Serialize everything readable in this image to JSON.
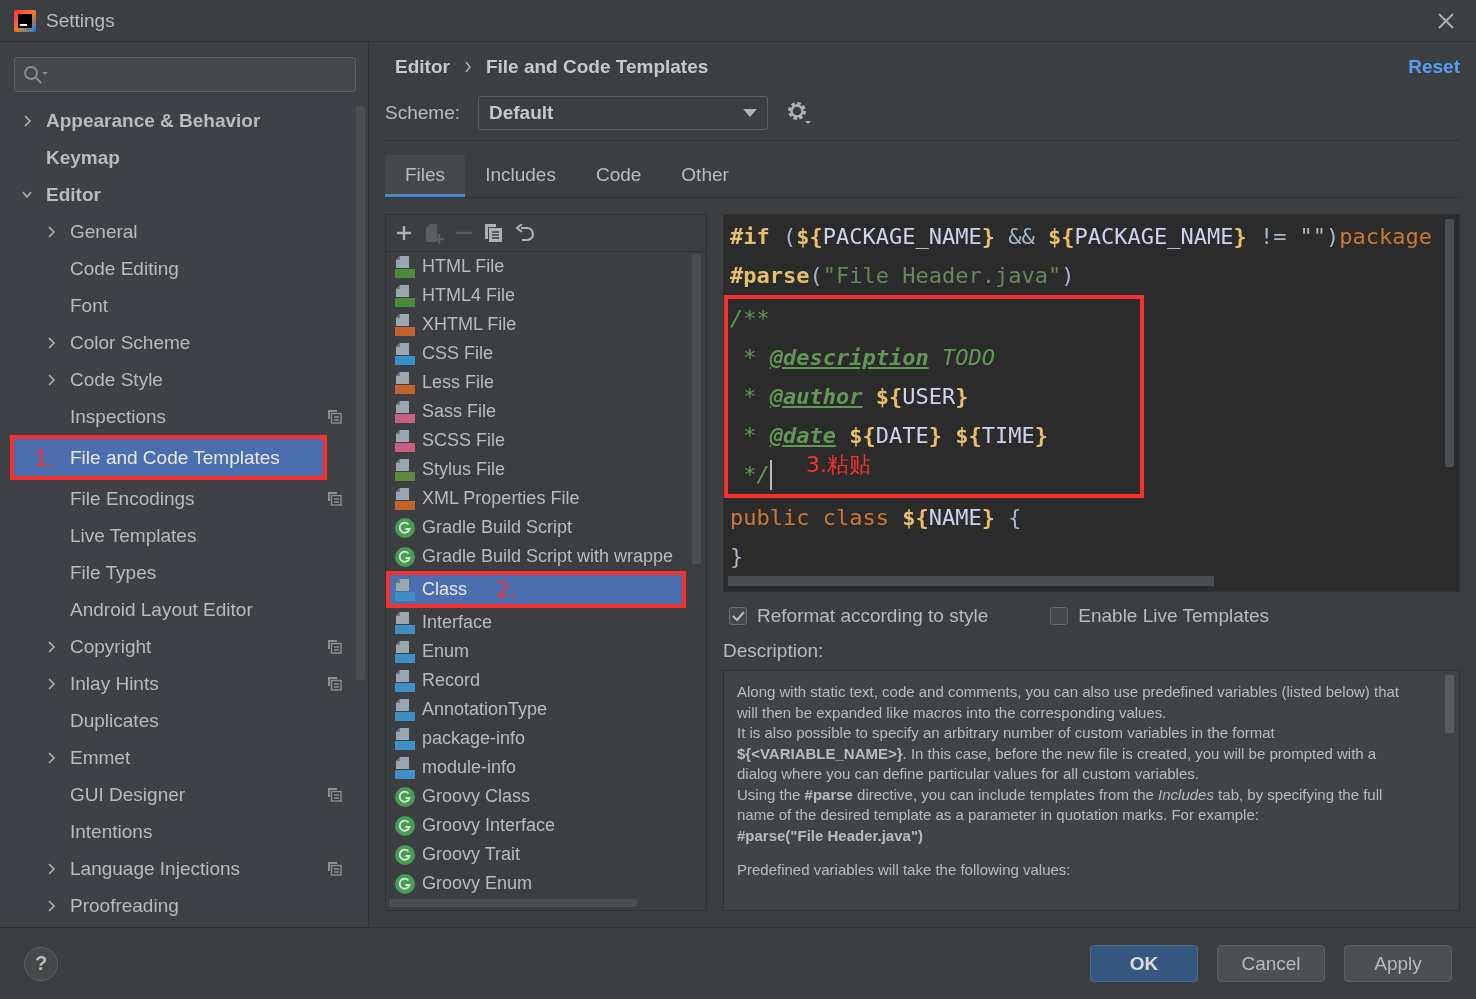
{
  "window": {
    "title": "Settings"
  },
  "sidebar": {
    "items": [
      {
        "label": "Appearance & Behavior",
        "expanded": false,
        "shared": false,
        "selected": false
      },
      {
        "label": "Keymap",
        "shared": false,
        "selected": false
      },
      {
        "label": "Editor",
        "expanded": true,
        "shared": false,
        "selected": false,
        "children": [
          {
            "label": "General",
            "expanded": false,
            "shared": false,
            "selected": false
          },
          {
            "label": "Code Editing",
            "shared": false,
            "selected": false
          },
          {
            "label": "Font",
            "shared": false,
            "selected": false
          },
          {
            "label": "Color Scheme",
            "expanded": false,
            "shared": false,
            "selected": false
          },
          {
            "label": "Code Style",
            "expanded": false,
            "shared": false,
            "selected": false
          },
          {
            "label": "Inspections",
            "shared": true,
            "selected": false
          },
          {
            "label": "File and Code Templates",
            "shared": false,
            "selected": true,
            "annotation": "1."
          },
          {
            "label": "File Encodings",
            "shared": true,
            "selected": false
          },
          {
            "label": "Live Templates",
            "shared": false,
            "selected": false
          },
          {
            "label": "File Types",
            "shared": false,
            "selected": false
          },
          {
            "label": "Android Layout Editor",
            "shared": false,
            "selected": false
          },
          {
            "label": "Copyright",
            "expanded": false,
            "shared": true,
            "selected": false
          },
          {
            "label": "Inlay Hints",
            "expanded": false,
            "shared": true,
            "selected": false
          },
          {
            "label": "Duplicates",
            "shared": false,
            "selected": false
          },
          {
            "label": "Emmet",
            "expanded": false,
            "shared": false,
            "selected": false
          },
          {
            "label": "GUI Designer",
            "shared": true,
            "selected": false
          },
          {
            "label": "Intentions",
            "shared": false,
            "selected": false
          },
          {
            "label": "Language Injections",
            "expanded": false,
            "shared": true,
            "selected": false
          },
          {
            "label": "Proofreading",
            "expanded": false,
            "shared": false,
            "selected": false
          }
        ]
      }
    ]
  },
  "breadcrumb": [
    "Editor",
    "File and Code Templates"
  ],
  "reset_link": "Reset",
  "scheme": {
    "label": "Scheme:",
    "value": "Default"
  },
  "tabs": [
    {
      "label": "Files",
      "selected": true
    },
    {
      "label": "Includes",
      "selected": false
    },
    {
      "label": "Code",
      "selected": false
    },
    {
      "label": "Other",
      "selected": false
    }
  ],
  "toolbar": [
    {
      "kind": "add",
      "disabled": false
    },
    {
      "kind": "add-child",
      "disabled": true
    },
    {
      "kind": "remove",
      "disabled": true
    },
    {
      "kind": "copy",
      "disabled": false
    },
    {
      "kind": "revert",
      "disabled": false
    }
  ],
  "templates": [
    {
      "label": "HTML File",
      "kind": "file",
      "color": "#4a8a3b",
      "selected": false
    },
    {
      "label": "HTML4 File",
      "kind": "file",
      "color": "#4a8a3b",
      "selected": false
    },
    {
      "label": "XHTML File",
      "kind": "file",
      "color": "#c3622c",
      "selected": false
    },
    {
      "label": "CSS File",
      "kind": "file",
      "color": "#3592c4",
      "selected": false
    },
    {
      "label": "Less File",
      "kind": "file",
      "color": "#c3622c",
      "selected": false
    },
    {
      "label": "Sass File",
      "kind": "file",
      "color": "#c75f80",
      "selected": false
    },
    {
      "label": "SCSS File",
      "kind": "file",
      "color": "#c75f80",
      "selected": false
    },
    {
      "label": "Stylus File",
      "kind": "file",
      "color": "#5b8a3a",
      "selected": false
    },
    {
      "label": "XML Properties File",
      "kind": "file",
      "color": "#c3622c",
      "selected": false
    },
    {
      "label": "Gradle Build Script",
      "kind": "circle",
      "color": "#499c54",
      "selected": false
    },
    {
      "label": "Gradle Build Script with wrappe",
      "kind": "circle",
      "color": "#499c54",
      "selected": false
    },
    {
      "label": "Class",
      "kind": "file",
      "color": "#3d8fc6",
      "selected": true,
      "annotation": "2."
    },
    {
      "label": "Interface",
      "kind": "file",
      "color": "#3d8fc6",
      "selected": false
    },
    {
      "label": "Enum",
      "kind": "file",
      "color": "#3d8fc6",
      "selected": false
    },
    {
      "label": "Record",
      "kind": "file",
      "color": "#3d8fc6",
      "selected": false
    },
    {
      "label": "AnnotationType",
      "kind": "file",
      "color": "#3d8fc6",
      "selected": false
    },
    {
      "label": "package-info",
      "kind": "file",
      "color": "#3d8fc6",
      "selected": false
    },
    {
      "label": "module-info",
      "kind": "file",
      "color": "#3d8fc6",
      "selected": false
    },
    {
      "label": "Groovy Class",
      "kind": "circle",
      "color": "#499c54",
      "selected": false
    },
    {
      "label": "Groovy Interface",
      "kind": "circle",
      "color": "#499c54",
      "selected": false
    },
    {
      "label": "Groovy Trait",
      "kind": "circle",
      "color": "#499c54",
      "selected": false
    },
    {
      "label": "Groovy Enum",
      "kind": "circle",
      "color": "#499c54",
      "selected": false
    }
  ],
  "code": {
    "before": [
      {
        "cursor": false,
        "tokens": [
          {
            "kind": "dir",
            "t": "#if"
          },
          {
            "kind": "plain",
            "t": " ("
          },
          {
            "kind": "brace",
            "t": "${"
          },
          {
            "kind": "var",
            "t": "PACKAGE_NAME"
          },
          {
            "kind": "brace",
            "t": "}"
          },
          {
            "kind": "plain",
            "t": " && "
          },
          {
            "kind": "brace",
            "t": "${"
          },
          {
            "kind": "var",
            "t": "PACKAGE_NAME"
          },
          {
            "kind": "brace",
            "t": "}"
          },
          {
            "kind": "plain",
            "t": " != \"\")"
          },
          {
            "kind": "kw",
            "t": "package"
          }
        ]
      },
      {
        "cursor": false,
        "tokens": [
          {
            "kind": "dir",
            "t": "#parse"
          },
          {
            "kind": "plain",
            "t": "("
          },
          {
            "kind": "str",
            "t": "\"File Header.java\""
          },
          {
            "kind": "plain",
            "t": ")"
          }
        ]
      }
    ],
    "annotated": {
      "label": "3.粘贴",
      "lines": [
        {
          "cursor": false,
          "tokens": [
            {
              "kind": "cmt",
              "t": "/**"
            }
          ]
        },
        {
          "cursor": false,
          "tokens": [
            {
              "kind": "cmt",
              "t": " * "
            },
            {
              "kind": "tag",
              "t": "@description"
            },
            {
              "kind": "cmt",
              "t": " TODO"
            }
          ]
        },
        {
          "cursor": false,
          "tokens": [
            {
              "kind": "cmt",
              "t": " * "
            },
            {
              "kind": "tag",
              "t": "@author"
            },
            {
              "kind": "brace",
              "t": " ${"
            },
            {
              "kind": "var",
              "t": "USER"
            },
            {
              "kind": "brace",
              "t": "}"
            }
          ]
        },
        {
          "cursor": false,
          "tokens": [
            {
              "kind": "cmt",
              "t": " * "
            },
            {
              "kind": "tag",
              "t": "@date"
            },
            {
              "kind": "brace",
              "t": " ${"
            },
            {
              "kind": "var",
              "t": "DATE"
            },
            {
              "kind": "brace",
              "t": "} ${"
            },
            {
              "kind": "var",
              "t": "TIME"
            },
            {
              "kind": "brace",
              "t": "}"
            }
          ]
        },
        {
          "cursor": true,
          "tokens": [
            {
              "kind": "cmt",
              "t": " */"
            }
          ]
        }
      ]
    },
    "after": [
      {
        "cursor": false,
        "tokens": [
          {
            "kind": "kw",
            "t": "public class "
          },
          {
            "kind": "brace",
            "t": "${"
          },
          {
            "kind": "var",
            "t": "NAME"
          },
          {
            "kind": "brace",
            "t": "}"
          },
          {
            "kind": "plain",
            "t": " {"
          }
        ]
      },
      {
        "cursor": false,
        "tokens": [
          {
            "kind": "plain",
            "t": "}"
          }
        ]
      }
    ]
  },
  "options": [
    {
      "label": "Reformat according to style",
      "checked": true
    },
    {
      "label": "Enable Live Templates",
      "checked": false
    }
  ],
  "description": {
    "label": "Description:",
    "paragraphs": [
      {
        "kind": "text",
        "text": "Along with static text, code and comments, you can also use predefined variables (listed below) that will then be expanded like macros into the corresponding values."
      },
      {
        "kind": "text",
        "text": "It is also possible to specify an arbitrary number of custom variables in the format **${<VARIABLE_NAME>}**. In this case, before the new file is created, you will be prompted with a dialog where you can define particular values for all custom variables."
      },
      {
        "kind": "text",
        "text": "Using the **#parse** directive, you can include templates from the *Includes* tab, by specifying the full name of the desired template as a parameter in quotation marks. For example:"
      },
      {
        "kind": "code",
        "text": "#parse(\"File Header.java\")"
      },
      {
        "kind": "note",
        "text": "Predefined variables will take the following values:"
      }
    ]
  },
  "footer": {
    "help": "?",
    "buttons": [
      {
        "label": "OK",
        "primary": true
      },
      {
        "label": "Cancel",
        "primary": false
      },
      {
        "label": "Apply",
        "primary": false
      }
    ]
  }
}
